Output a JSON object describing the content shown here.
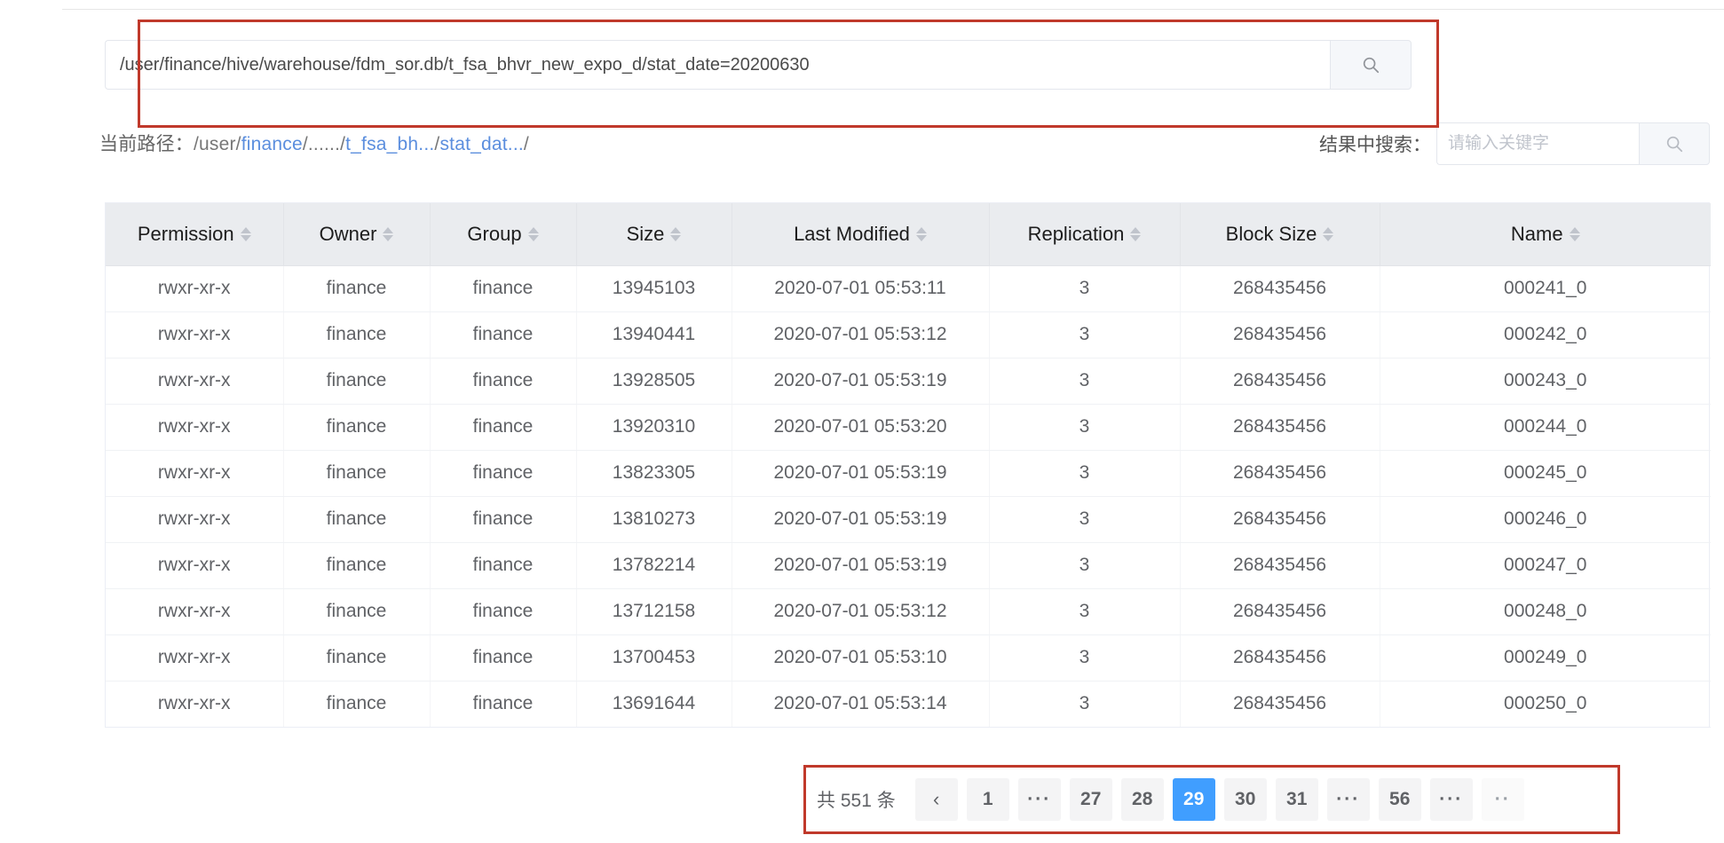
{
  "search": {
    "value": "/user/finance/hive/warehouse/fdm_sor.db/t_fsa_bhvr_new_expo_d/stat_date=20200630",
    "placeholder": "",
    "button_icon": "search-icon"
  },
  "breadcrumb": {
    "label": "当前路径：",
    "prefix": "/user/",
    "seg1": "finance",
    "mid": "/....../",
    "seg2": "t_fsa_bh...",
    "sep2": "/",
    "seg3": "stat_dat...",
    "suffix": "/"
  },
  "result_search": {
    "label": "结果中搜索：",
    "placeholder": "请输入关键字",
    "value": "",
    "button_icon": "search-icon"
  },
  "table": {
    "columns": [
      {
        "key": "permission",
        "label": "Permission",
        "sortable": true
      },
      {
        "key": "owner",
        "label": "Owner",
        "sortable": true
      },
      {
        "key": "group",
        "label": "Group",
        "sortable": true
      },
      {
        "key": "size",
        "label": "Size",
        "sortable": true
      },
      {
        "key": "last_modified",
        "label": "Last Modified",
        "sortable": true
      },
      {
        "key": "replication",
        "label": "Replication",
        "sortable": true
      },
      {
        "key": "block_size",
        "label": "Block Size",
        "sortable": true
      },
      {
        "key": "name",
        "label": "Name",
        "sortable": true
      }
    ],
    "rows": [
      {
        "permission": "rwxr-xr-x",
        "owner": "finance",
        "group": "finance",
        "size": "13945103",
        "last_modified": "2020-07-01 05:53:11",
        "replication": "3",
        "block_size": "268435456",
        "name": "000241_0"
      },
      {
        "permission": "rwxr-xr-x",
        "owner": "finance",
        "group": "finance",
        "size": "13940441",
        "last_modified": "2020-07-01 05:53:12",
        "replication": "3",
        "block_size": "268435456",
        "name": "000242_0"
      },
      {
        "permission": "rwxr-xr-x",
        "owner": "finance",
        "group": "finance",
        "size": "13928505",
        "last_modified": "2020-07-01 05:53:19",
        "replication": "3",
        "block_size": "268435456",
        "name": "000243_0"
      },
      {
        "permission": "rwxr-xr-x",
        "owner": "finance",
        "group": "finance",
        "size": "13920310",
        "last_modified": "2020-07-01 05:53:20",
        "replication": "3",
        "block_size": "268435456",
        "name": "000244_0"
      },
      {
        "permission": "rwxr-xr-x",
        "owner": "finance",
        "group": "finance",
        "size": "13823305",
        "last_modified": "2020-07-01 05:53:19",
        "replication": "3",
        "block_size": "268435456",
        "name": "000245_0"
      },
      {
        "permission": "rwxr-xr-x",
        "owner": "finance",
        "group": "finance",
        "size": "13810273",
        "last_modified": "2020-07-01 05:53:19",
        "replication": "3",
        "block_size": "268435456",
        "name": "000246_0"
      },
      {
        "permission": "rwxr-xr-x",
        "owner": "finance",
        "group": "finance",
        "size": "13782214",
        "last_modified": "2020-07-01 05:53:19",
        "replication": "3",
        "block_size": "268435456",
        "name": "000247_0"
      },
      {
        "permission": "rwxr-xr-x",
        "owner": "finance",
        "group": "finance",
        "size": "13712158",
        "last_modified": "2020-07-01 05:53:12",
        "replication": "3",
        "block_size": "268435456",
        "name": "000248_0"
      },
      {
        "permission": "rwxr-xr-x",
        "owner": "finance",
        "group": "finance",
        "size": "13700453",
        "last_modified": "2020-07-01 05:53:10",
        "replication": "3",
        "block_size": "268435456",
        "name": "000249_0"
      },
      {
        "permission": "rwxr-xr-x",
        "owner": "finance",
        "group": "finance",
        "size": "13691644",
        "last_modified": "2020-07-01 05:53:14",
        "replication": "3",
        "block_size": "268435456",
        "name": "000250_0"
      }
    ]
  },
  "pagination": {
    "total_label": "共 551 条",
    "total_count": 551,
    "current_page": 29,
    "last_page": 56,
    "prev_label": "‹",
    "items": [
      {
        "label": "‹",
        "type": "prev"
      },
      {
        "label": "1",
        "type": "page"
      },
      {
        "label": "···",
        "type": "ellipsis"
      },
      {
        "label": "27",
        "type": "page"
      },
      {
        "label": "28",
        "type": "page"
      },
      {
        "label": "29",
        "type": "page",
        "active": true
      },
      {
        "label": "30",
        "type": "page"
      },
      {
        "label": "31",
        "type": "page"
      },
      {
        "label": "···",
        "type": "ellipsis"
      },
      {
        "label": "56",
        "type": "page"
      },
      {
        "label": "···",
        "type": "ellipsis"
      },
      {
        "label": "··",
        "type": "next-clipped"
      }
    ]
  },
  "colors": {
    "accent": "#409eff",
    "annotation": "#c0392b",
    "header_bg": "#eaecef",
    "link": "#5b8ede"
  }
}
